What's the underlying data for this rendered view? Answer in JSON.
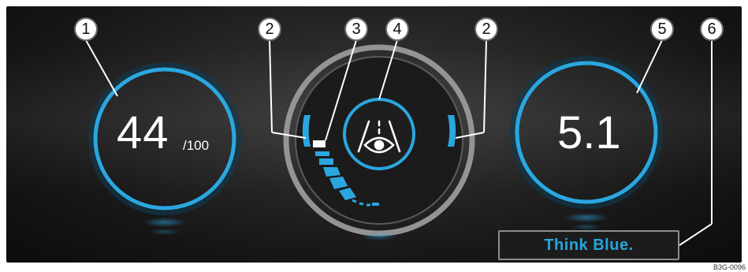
{
  "display": {
    "score": {
      "value": "44",
      "max": "/100"
    },
    "consumption": {
      "value": "5.1"
    },
    "think_blue": {
      "label": "Think Blue."
    },
    "anticipation": {
      "icon": "eye-road-icon",
      "level_segments_lit": 5,
      "level_segments_total": 6
    }
  },
  "callouts": [
    "1",
    "2",
    "3",
    "4",
    "2",
    "5",
    "6"
  ],
  "image_code": "B3G-0096",
  "colors": {
    "accent_blue": "#25a6dd",
    "ring_blue": "#2aa7e0",
    "ring_grey": "#bdbdbd",
    "background": "#1a1a1a"
  }
}
